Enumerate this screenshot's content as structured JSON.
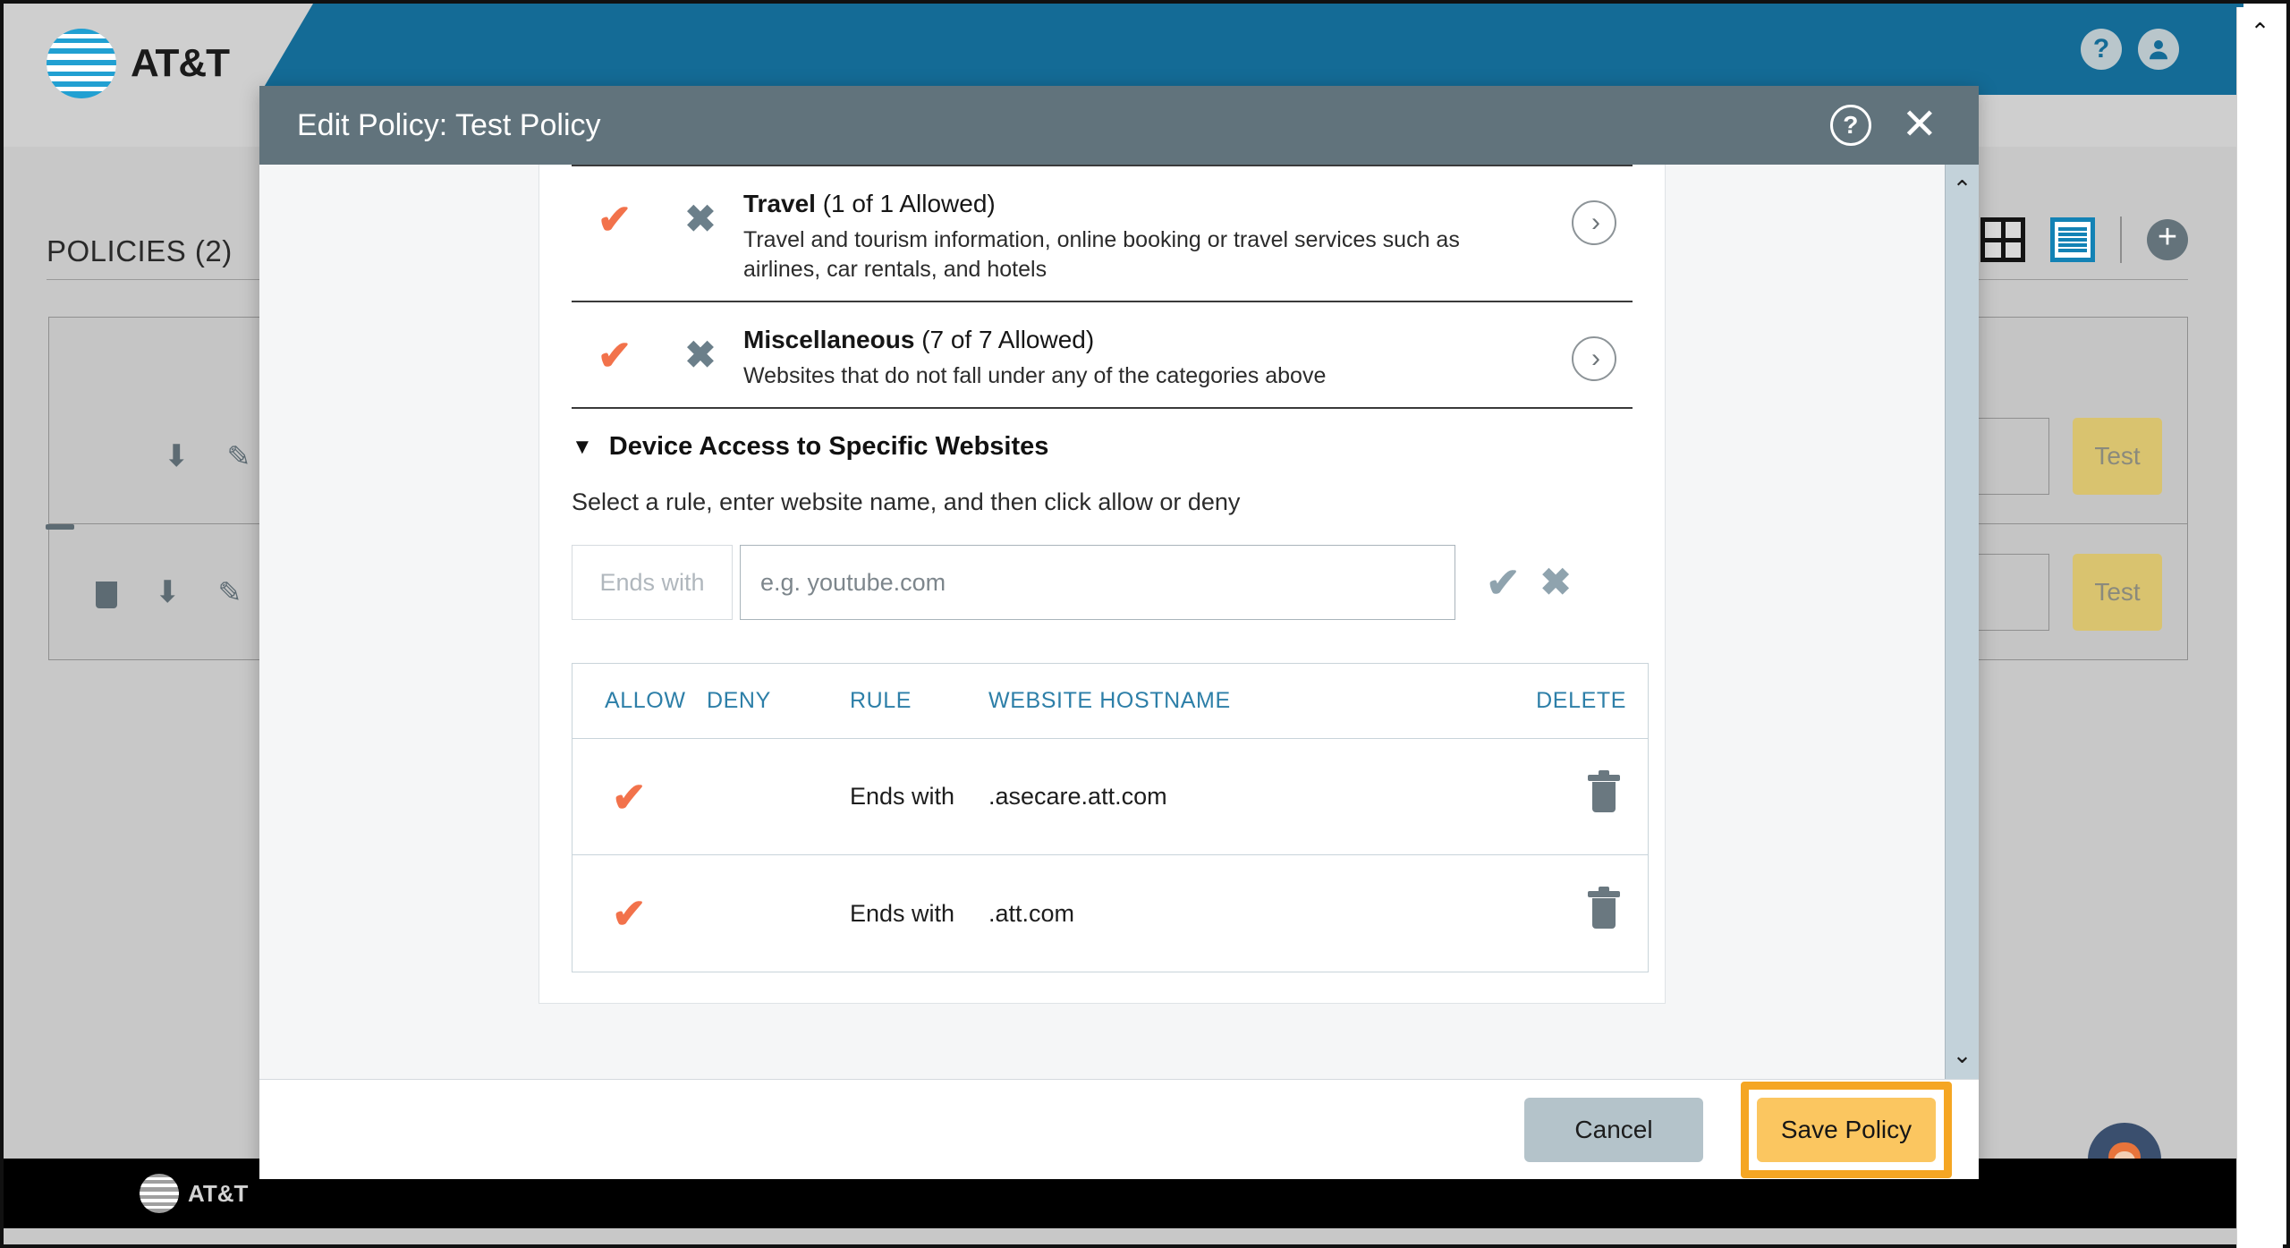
{
  "app": {
    "brand": "AT&T",
    "footer_brand": "AT&T",
    "header_icons": [
      {
        "name": "help-icon",
        "glyph": "?"
      },
      {
        "name": "account-icon",
        "glyph": "●"
      }
    ],
    "policies_title": "POLICIES (2)",
    "toolbar": {
      "grid_view": "grid-view-icon",
      "list_view": "list-view-icon",
      "add": "+"
    },
    "rows": [
      {
        "icons": [
          "download-icon",
          "edit-icon"
        ],
        "test_label": "Test"
      },
      {
        "icons": [
          "trash-icon",
          "download-icon",
          "edit-icon"
        ],
        "test_label": "Test"
      }
    ],
    "chat_avatar": "chat-avatar-icon"
  },
  "modal": {
    "title": "Edit Policy: Test Policy",
    "help_glyph": "?",
    "close_glyph": "✕",
    "categories": [
      {
        "name": "Travel",
        "count_text": "(1 of 1 Allowed)",
        "allowed": "1",
        "total": "1",
        "description": "Travel and tourism information, online booking or travel services such as airlines, car rentals, and hotels",
        "allow_glyph": "✔",
        "deny_glyph": "✖",
        "chevron_glyph": "›"
      },
      {
        "name": "Miscellaneous",
        "count_text": "(7 of 7 Allowed)",
        "allowed": "7",
        "total": "7",
        "description": "Websites that do not fall under any of the categories above",
        "allow_glyph": "✔",
        "deny_glyph": "✖",
        "chevron_glyph": "›"
      }
    ],
    "device_section": {
      "caret": "▼",
      "title": "Device Access to Specific Websites",
      "instruction": "Select a rule, enter website name, and then click allow or deny",
      "rule_select_value": "Ends with",
      "hostname_placeholder": "e.g. youtube.com",
      "hostname_value": "",
      "confirm_glyph": "✔",
      "cancel_glyph": "✖"
    },
    "rules_table": {
      "headers": [
        "ALLOW",
        "DENY",
        "RULE",
        "WEBSITE HOSTNAME",
        "DELETE"
      ],
      "rows": [
        {
          "allow": "✔",
          "deny": "",
          "rule": "Ends with",
          "hostname": ".asecare.att.com",
          "delete": "trash-icon"
        },
        {
          "allow": "✔",
          "deny": "",
          "rule": "Ends with",
          "hostname": ".att.com",
          "delete": "trash-icon"
        }
      ]
    },
    "footer": {
      "cancel_label": "Cancel",
      "save_label": "Save Policy"
    },
    "scrollbar": {
      "up": "⌃",
      "down": "⌄"
    }
  },
  "colors": {
    "brand_teal": "#146b96",
    "accent_orange": "#f2724b",
    "highlight_yellow": "#f5a623",
    "save_button": "#fbc660",
    "modal_header": "#61737c",
    "link_blue": "#2d7fa8"
  }
}
